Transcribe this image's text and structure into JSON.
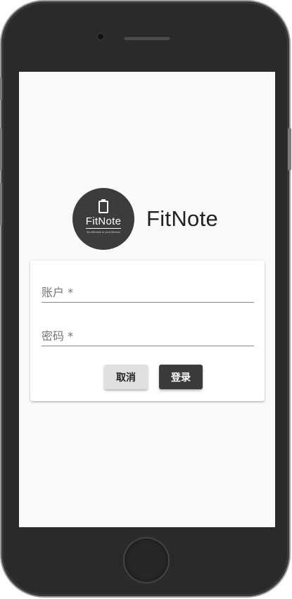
{
  "app": {
    "name": "FitNote",
    "logo_text": "FitNote",
    "logo_tagline": "Be effective in your fitness!"
  },
  "login": {
    "account_placeholder": "账户 *",
    "password_placeholder": "密码 *",
    "cancel_label": "取消",
    "login_label": "登录"
  },
  "colors": {
    "primary": "#3a3a3a",
    "secondary_button": "#e0e0e0",
    "background": "#fafafa"
  }
}
